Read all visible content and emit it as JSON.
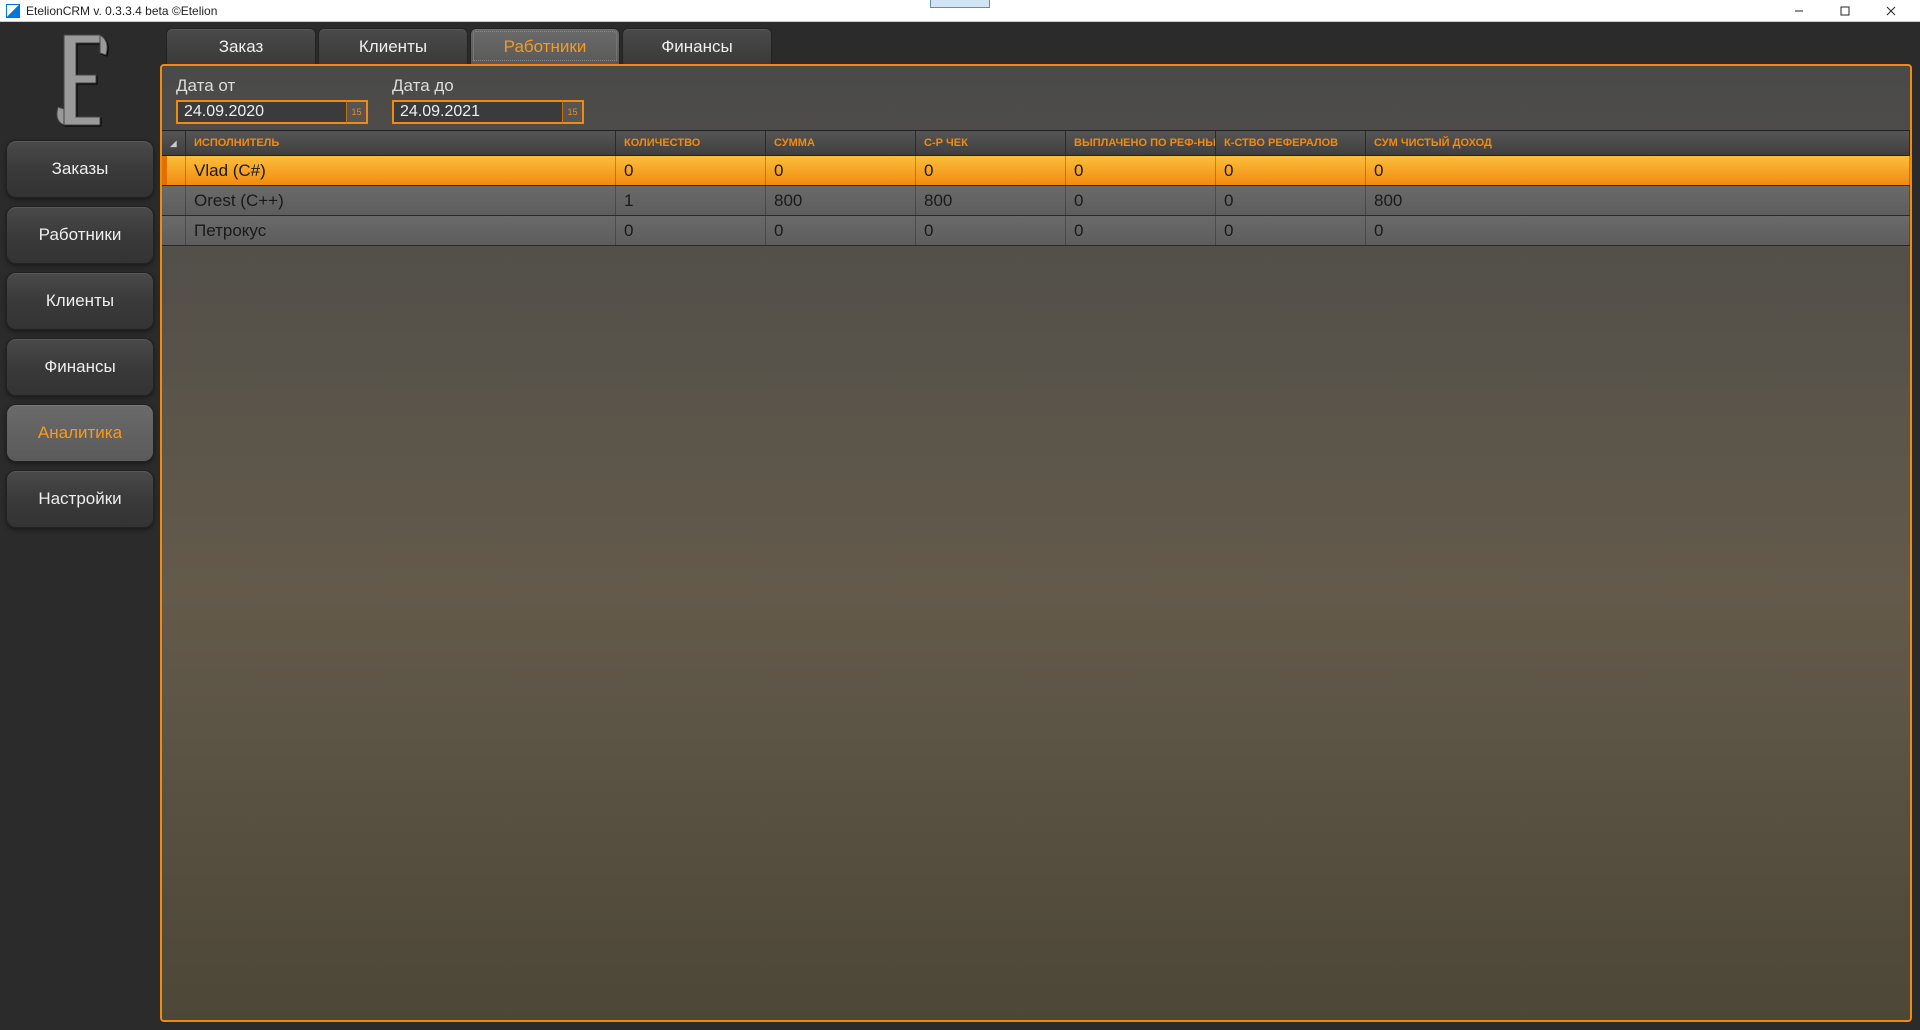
{
  "window": {
    "title": "EtelionCRM v. 0.3.3.4 beta ©Etelion"
  },
  "sidebar": {
    "items": [
      {
        "label": "Заказы",
        "active": false
      },
      {
        "label": "Работники",
        "active": false
      },
      {
        "label": "Клиенты",
        "active": false
      },
      {
        "label": "Финансы",
        "active": false
      },
      {
        "label": "Аналитика",
        "active": true
      },
      {
        "label": "Настройки",
        "active": false
      }
    ]
  },
  "tabs": [
    {
      "label": "Заказ",
      "active": false
    },
    {
      "label": "Клиенты",
      "active": false
    },
    {
      "label": "Работники",
      "active": true
    },
    {
      "label": "Финансы",
      "active": false
    }
  ],
  "filters": {
    "date_from_label": "Дата от",
    "date_to_label": "Дата до",
    "date_from_value": "24.09.2020",
    "date_to_value": "24.09.2021",
    "cal_badge": "15"
  },
  "table": {
    "headers": {
      "performer": "ИСПОЛНИТЕЛЬ",
      "qty": "КОЛИЧЕСТВО",
      "sum": "СУММА",
      "avg": "С-Р ЧЕК",
      "paid_ref": "ВЫПЛАЧЕНО ПО РЕФ-НЫХ",
      "ref_count": "К-СТВО РЕФЕРАЛОВ",
      "net": "СУМ ЧИСТЫЙ ДОХОД"
    },
    "rows": [
      {
        "performer": "Vlad (C#)",
        "qty": "0",
        "sum": "0",
        "avg": "0",
        "paid_ref": "0",
        "ref_count": "0",
        "net": "0",
        "selected": true
      },
      {
        "performer": "Orest (C++)",
        "qty": "1",
        "sum": "800",
        "avg": "800",
        "paid_ref": "0",
        "ref_count": "0",
        "net": "800",
        "selected": false
      },
      {
        "performer": "Петрокус",
        "qty": "0",
        "sum": "0",
        "avg": "0",
        "paid_ref": "0",
        "ref_count": "0",
        "net": "0",
        "selected": false
      }
    ]
  },
  "colors": {
    "accent": "#f28a0f",
    "accent_bright": "#fbbf3c",
    "bg": "#2b2b2b"
  }
}
